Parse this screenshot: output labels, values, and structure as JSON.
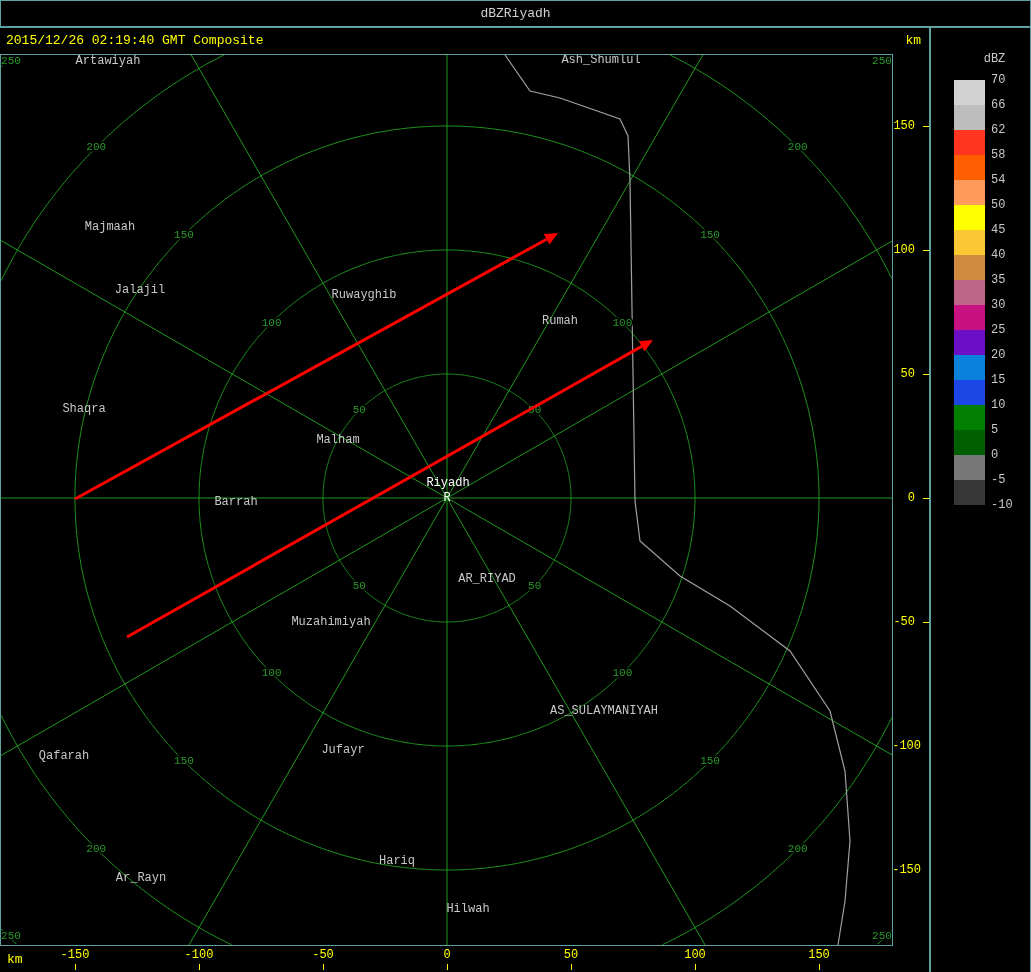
{
  "window": {
    "title": "dBZRiyadh"
  },
  "header": {
    "timestamp": "2015/12/26 02:19:40 GMT Composite",
    "unit": "km"
  },
  "map": {
    "rings": [
      {
        "labels": [
          "50",
          "50",
          "50",
          "50"
        ]
      },
      {
        "labels": [
          "100",
          "100",
          "100",
          "100"
        ]
      },
      {
        "labels": [
          "150",
          "150",
          "150",
          "150"
        ]
      },
      {
        "labels": [
          "200",
          "200",
          "200",
          "200"
        ]
      },
      {
        "labels": [
          "250",
          "250",
          "250",
          "250"
        ]
      }
    ],
    "places": [
      {
        "name": "Artawiyah",
        "kind": "town"
      },
      {
        "name": "Ash_Shumlul",
        "kind": "town"
      },
      {
        "name": "Majmaah",
        "kind": "town"
      },
      {
        "name": "Jalajil",
        "kind": "town"
      },
      {
        "name": "Ruwayghib",
        "kind": "town"
      },
      {
        "name": "Rumah",
        "kind": "town"
      },
      {
        "name": "Shaqra",
        "kind": "town"
      },
      {
        "name": "Malham",
        "kind": "town"
      },
      {
        "name": "Riyadh",
        "kind": "radar"
      },
      {
        "name": "Barrah",
        "kind": "town"
      },
      {
        "name": "AR_RIYAD",
        "kind": "town"
      },
      {
        "name": "Muzahimiyah",
        "kind": "town"
      },
      {
        "name": "AS_SULAYMANIYAH",
        "kind": "town"
      },
      {
        "name": "Jufayr",
        "kind": "town"
      },
      {
        "name": "Qafarah",
        "kind": "town"
      },
      {
        "name": "Hariq",
        "kind": "town"
      },
      {
        "name": "Ar_Rayn",
        "kind": "town"
      },
      {
        "name": "Hilwah",
        "kind": "town"
      }
    ],
    "radar_mark": "R"
  },
  "right_axis": {
    "ticks": [
      "150",
      "100",
      "50",
      "0",
      "-50",
      "-100",
      "-150"
    ]
  },
  "bottom_axis": {
    "unit": "km",
    "ticks": [
      "-150",
      "-100",
      "-50",
      "0",
      "50",
      "100",
      "150"
    ]
  },
  "legend": {
    "title": "dBZ",
    "bands": [
      {
        "color": "#d3d3d3"
      },
      {
        "color": "#bebebe"
      },
      {
        "color": "#ff3520"
      },
      {
        "color": "#ff5e00"
      },
      {
        "color": "#ff9a5a"
      },
      {
        "color": "#ffff00"
      },
      {
        "color": "#fac832"
      },
      {
        "color": "#d08a40"
      },
      {
        "color": "#bf6688"
      },
      {
        "color": "#c81282"
      },
      {
        "color": "#6c10c8"
      },
      {
        "color": "#0a82dc"
      },
      {
        "color": "#1c46e6"
      },
      {
        "color": "#007f00"
      },
      {
        "color": "#005f00"
      },
      {
        "color": "#787878"
      },
      {
        "color": "#373737"
      }
    ],
    "labels": [
      "70",
      "66",
      "62",
      "58",
      "54",
      "50",
      "45",
      "40",
      "35",
      "30",
      "25",
      "20",
      "15",
      "10",
      "5",
      "0",
      "-5",
      "-10"
    ]
  }
}
